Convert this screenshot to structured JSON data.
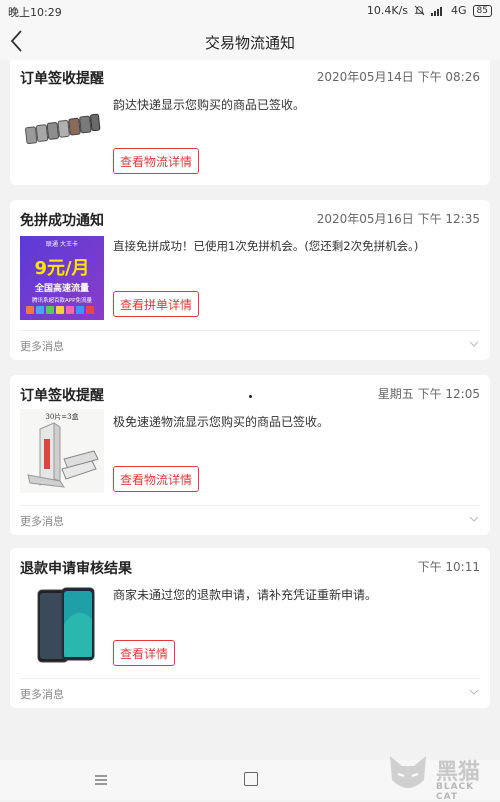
{
  "status_bar": {
    "time": "晚上10:29",
    "network_speed": "10.4K/s",
    "network_type": "4G",
    "battery": "85"
  },
  "header": {
    "title": "交易物流通知"
  },
  "cards": [
    {
      "title": "订单签收提醒",
      "time": "2020年05月14日 下午 08:26",
      "message": "韵达快递显示您购买的商品已签收。",
      "button": "查看物流详情"
    },
    {
      "title": "免拼成功通知",
      "time": "2020年05月16日 下午 12:35",
      "message": "直接免拼成功！已使用1次免拼机会。(您还剩2次免拼机会。)",
      "button": "查看拼单详情",
      "more": "更多消息",
      "thumb": {
        "top": "联通 大王卡",
        "price": "9元/月",
        "sub": "全国高速流量",
        "desc": "腾讯系超百款APP免流量"
      }
    },
    {
      "title": "订单签收提醒",
      "time": "星期五 下午 12:05",
      "message": "极免速递物流显示您购买的商品已签收。",
      "button": "查看物流详情",
      "more": "更多消息",
      "thumb": {
        "label": "30片=3盒"
      }
    },
    {
      "title": "退款申请审核结果",
      "time": "下午 10:11",
      "message": "商家未通过您的退款申请，请补充凭证重新申请。",
      "button": "查看详情",
      "more": "更多消息"
    }
  ],
  "watermark": {
    "text": "黑猫",
    "sub": "BLACK CAT"
  },
  "icons": {
    "back": "chevron-left-icon",
    "more": "chevron-down-icon",
    "menu": "menu-icon",
    "home": "home-square-icon",
    "mute": "bell-off-icon"
  },
  "colors": {
    "accent": "#e4393c",
    "background": "#f2f2f2"
  }
}
